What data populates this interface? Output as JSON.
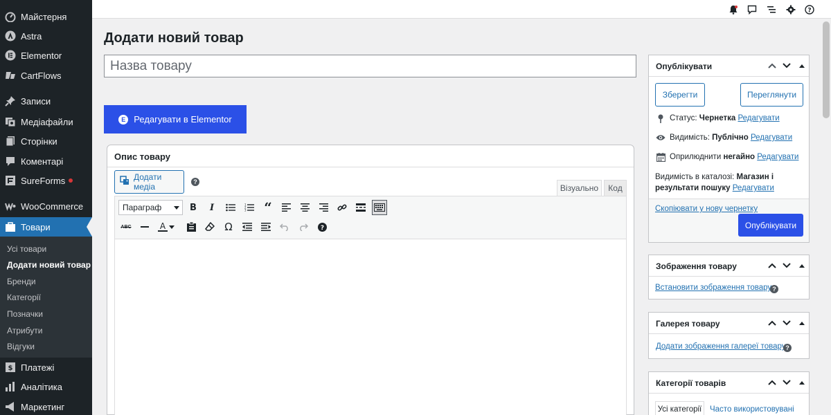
{
  "sidebar": {
    "items": [
      {
        "label": "Майстерня",
        "icon": "dashboard-icon"
      },
      {
        "label": "Astra",
        "icon": "astra-icon"
      },
      {
        "label": "Elementor",
        "icon": "elementor-icon"
      },
      {
        "label": "CartFlows",
        "icon": "cartflows-icon"
      },
      {
        "label": "Записи",
        "icon": "pin-icon"
      },
      {
        "label": "Медіафайли",
        "icon": "media-icon"
      },
      {
        "label": "Сторінки",
        "icon": "pages-icon"
      },
      {
        "label": "Коментарі",
        "icon": "comments-icon"
      },
      {
        "label": "SureForms",
        "icon": "sureforms-icon"
      },
      {
        "label": "WooCommerce",
        "icon": "woocommerce-icon"
      },
      {
        "label": "Товари",
        "icon": "products-icon"
      },
      {
        "label": "Платежі",
        "icon": "payments-icon"
      },
      {
        "label": "Аналітика",
        "icon": "analytics-icon"
      },
      {
        "label": "Маркетинг",
        "icon": "marketing-icon"
      }
    ],
    "submenu": [
      "Усі товари",
      "Додати новий товар",
      "Бренди",
      "Категорії",
      "Позначки",
      "Атрибути",
      "Відгуки"
    ]
  },
  "page": {
    "title": "Додати новий товар",
    "title_placeholder": "Назва товару",
    "elementor_button": "Редагувати в Elementor"
  },
  "description": {
    "title": "Опис товару",
    "add_media": "Додати медіа",
    "tab_visual": "Візуально",
    "tab_code": "Код",
    "format_select": "Параграф"
  },
  "publish": {
    "title": "Опублікувати",
    "save": "Зберегти",
    "preview": "Переглянути",
    "status_label": "Статус:",
    "status_value": "Чернетка",
    "visibility_label": "Видимість:",
    "visibility_value": "Публічно",
    "publish_label": "Оприлюднити",
    "publish_value": "негайно",
    "edit": "Редагувати",
    "catalog_label": "Видимість в каталозі:",
    "catalog_value": "Магазин і результати пошуку",
    "copy_draft": "Скопіювати у нову чернетку",
    "publish_button": "Опублікувати"
  },
  "product_image": {
    "title": "Зображення товару",
    "link": "Встановити зображення товару"
  },
  "gallery": {
    "title": "Галерея товару",
    "link": "Додати зображення галереї товару"
  },
  "categories": {
    "title": "Категорії товарів",
    "tab_all": "Усі категорії",
    "tab_frequent": "Часто використовувані"
  },
  "colors": {
    "sidebar_bg": "#1d2327",
    "active": "#2271b1",
    "primary_button": "#2b50e7"
  }
}
